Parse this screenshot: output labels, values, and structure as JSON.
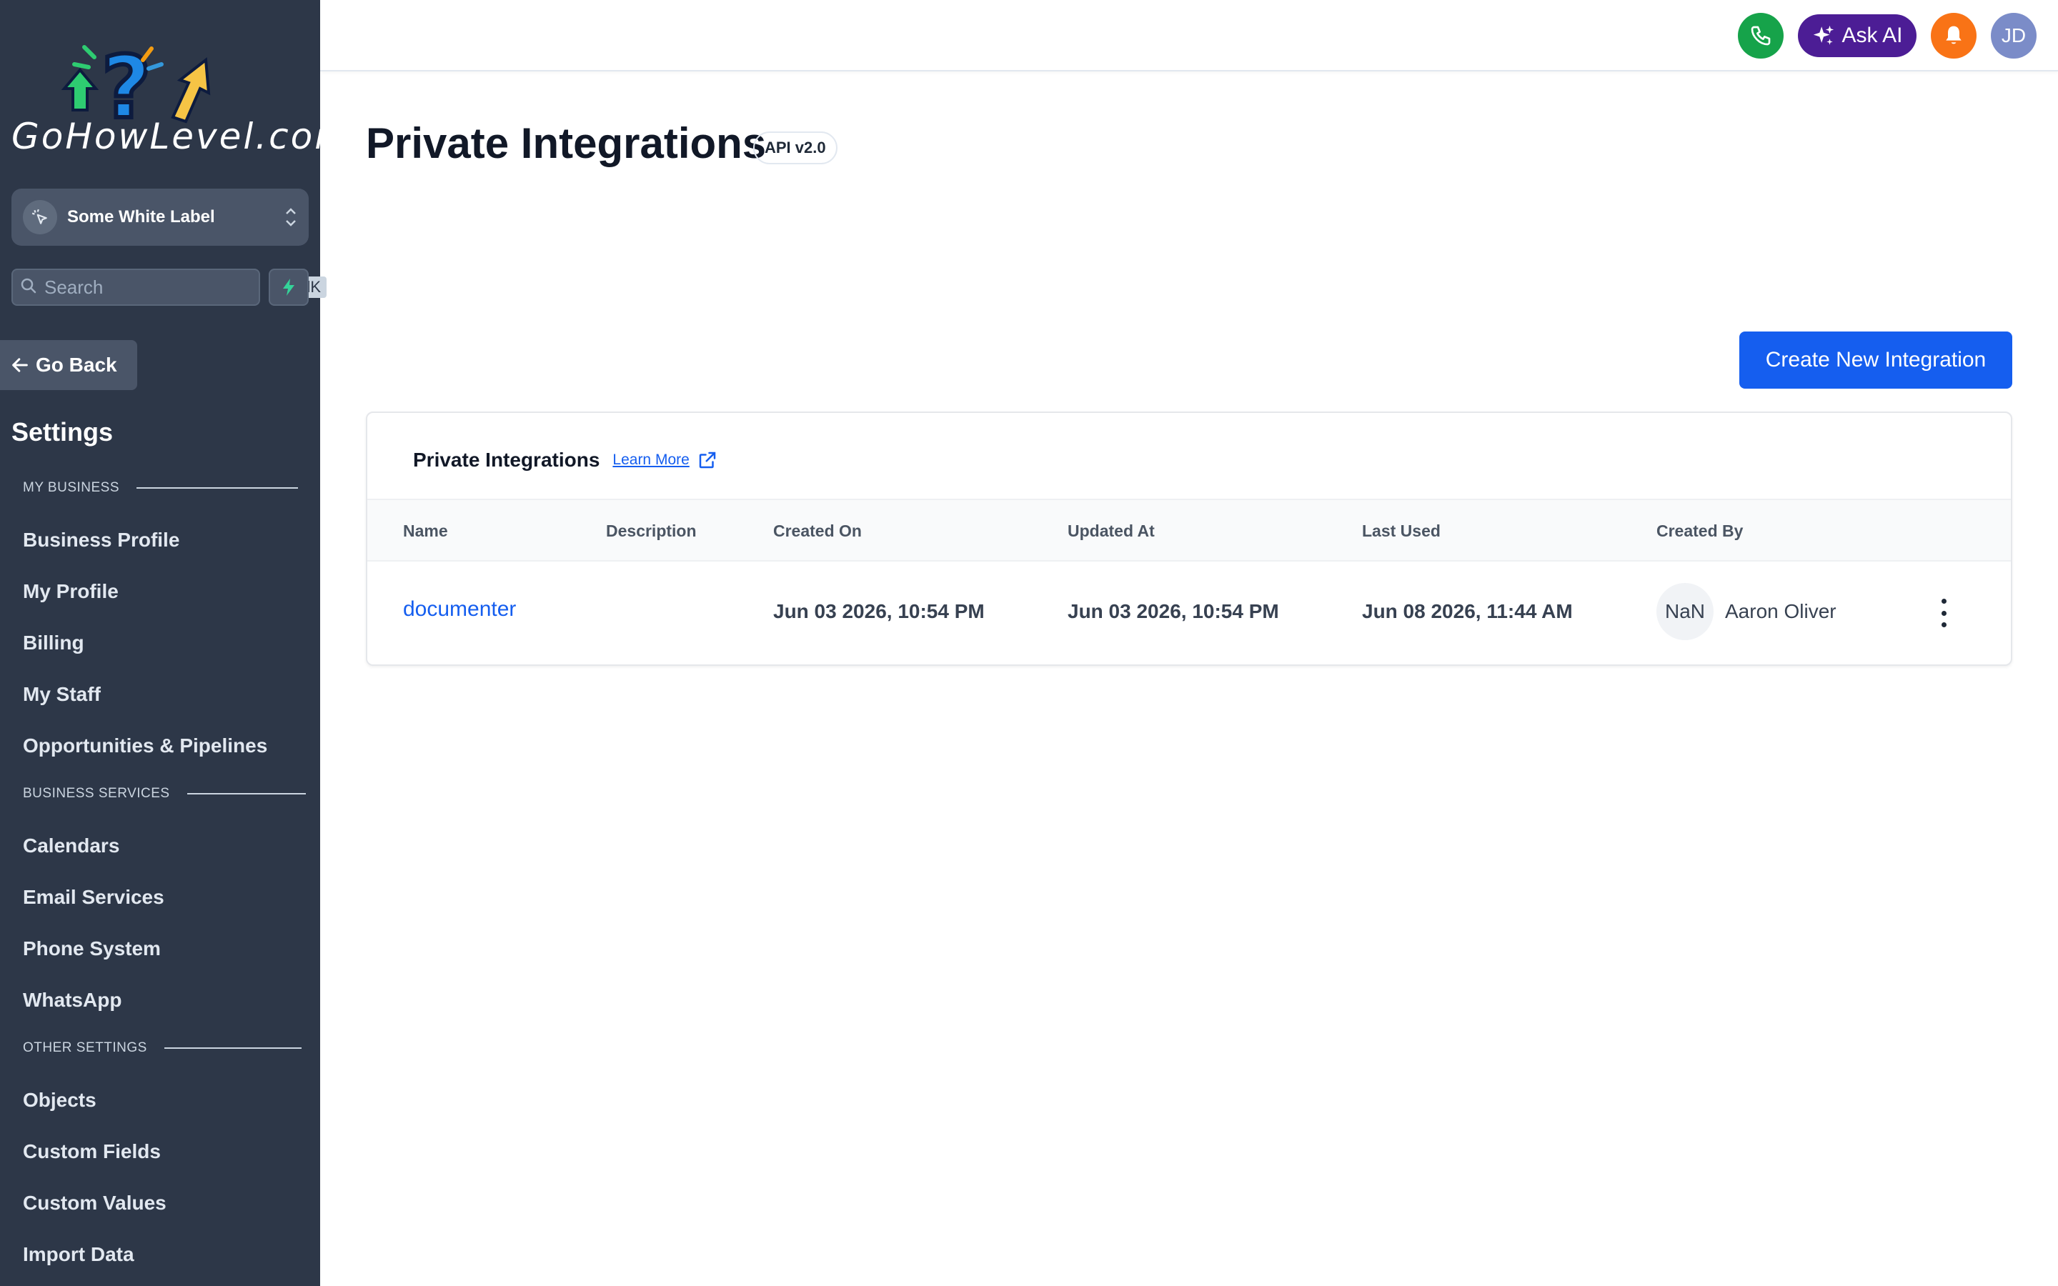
{
  "brand": {
    "logo_text": "GoHowLevel.com"
  },
  "location": {
    "name": "Some White Label"
  },
  "search": {
    "placeholder": "Search",
    "shortcut": "ctrlK"
  },
  "nav": {
    "go_back": "Go Back",
    "settings_title": "Settings",
    "sections": [
      {
        "label": "MY BUSINESS",
        "items": [
          "Business Profile",
          "My Profile",
          "Billing",
          "My Staff",
          "Opportunities & Pipelines"
        ]
      },
      {
        "label": "BUSINESS SERVICES",
        "items": [
          "Calendars",
          "Email Services",
          "Phone System",
          "WhatsApp"
        ]
      },
      {
        "label": "OTHER SETTINGS",
        "items": [
          "Objects",
          "Custom Fields",
          "Custom Values",
          "Import Data"
        ]
      }
    ]
  },
  "topbar": {
    "ask_ai_label": "Ask AI",
    "user_initials": "JD"
  },
  "page": {
    "title": "Private Integrations",
    "api_badge": "API v2.0",
    "create_button": "Create New Integration"
  },
  "card": {
    "title": "Private Integrations",
    "learn_more": "Learn More",
    "columns": [
      "Name",
      "Description",
      "Created On",
      "Updated At",
      "Last Used",
      "Created By"
    ],
    "rows": [
      {
        "name": "documenter",
        "description": "",
        "created_on": "Jun 03 2026, 10:54 PM",
        "updated_at": "Jun 03 2026, 10:54 PM",
        "last_used": "Jun 08 2026, 11:44 AM",
        "creator_avatar": "NaN",
        "created_by": "Aaron Oliver"
      }
    ]
  },
  "colors": {
    "sidebar_bg": "#2d3748",
    "primary": "#155eef",
    "phone": "#16a34a",
    "ask_ai": "#4c1d95",
    "bell": "#f97316"
  }
}
